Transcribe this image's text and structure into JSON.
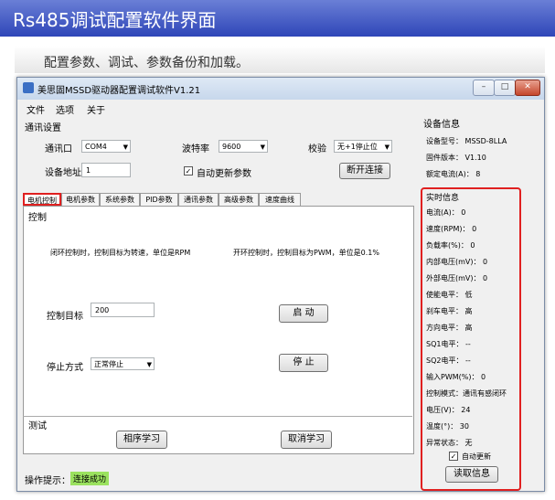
{
  "slide": {
    "title": "Rs485调试配置软件界面",
    "subtitle": "配置参数、调试、参数备份和加载。"
  },
  "window": {
    "title": "美思固MSSD驱动器配置调试软件V1.21",
    "buttons": [
      "–",
      "□",
      "✕"
    ]
  },
  "menu": [
    "文件",
    "选项",
    "关于"
  ],
  "comm": {
    "group_label": "通讯设置",
    "port_label": "通讯口",
    "port_value": "COM4",
    "baud_label": "波特率",
    "baud_value": "9600",
    "parity_label": "校验",
    "parity_value": "无+1停止位",
    "address_label": "设备地址",
    "address_value": "1",
    "auto_update_label": "自动更新参数",
    "auto_update_checked": true,
    "disconnect_button": "断开连接"
  },
  "tabs": [
    "电机控制",
    "电机参数",
    "系统参数",
    "PID参数",
    "通讯参数",
    "高级参数",
    "速度曲线"
  ],
  "control": {
    "group_label": "控制",
    "closed_loop_note": "闭环控制时，控制目标为转速，单位是RPM",
    "open_loop_note": "开环控制时，控制目标为PWM，单位是0.1%",
    "target_label": "控制目标",
    "target_value": "200",
    "start_button": "启 动",
    "stop_mode_label": "停止方式",
    "stop_mode_value": "正常停止",
    "stop_button": "停 止"
  },
  "test": {
    "group_label": "测试",
    "phase_learn_button": "相序学习",
    "cancel_learn_button": "取消学习"
  },
  "status": {
    "label": "操作提示：",
    "value": "连接成功"
  },
  "device_info": {
    "group_label": "设备信息",
    "model": "设备型号：  MSSD-8LLA",
    "firmware": "固件版本：  V1.10",
    "rated_current": "额定电流(A)：  8"
  },
  "realtime": {
    "group_label": "实时信息",
    "rows": [
      "电流(A)：  0",
      "速度(RPM)：  0",
      "负载率(%)：  0",
      "内部电压(mV)：  0",
      "外部电压(mV)：  0",
      "使能电平：  低",
      "刹车电平：  高",
      "方向电平：  高",
      "SQ1电平：   --",
      "SQ2电平：   --",
      "输入PWM(%)：  0",
      "控制模式：通讯有感闭环",
      "电压(V)：  24",
      "温度(°)：  30",
      "异常状态：  无"
    ],
    "auto_refresh_label": "自动更新",
    "auto_refresh_checked": true,
    "read_button": "读取信息"
  },
  "colors": {
    "header_blue": "#2f46b8",
    "highlight_red": "#e02020",
    "status_green": "#9be25f"
  }
}
